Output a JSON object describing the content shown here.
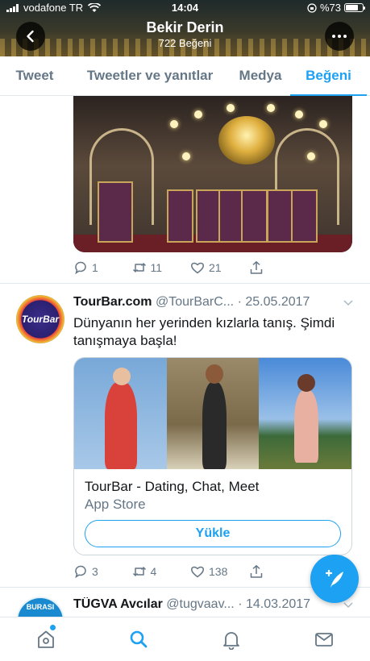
{
  "status_bar": {
    "carrier": "vodafone TR",
    "time": "14:04",
    "battery_text": "%73",
    "battery_level": 0.73
  },
  "header": {
    "name": "Bekir Derin",
    "subtitle": "722 Beğeni"
  },
  "tabs": [
    {
      "label": "Tweet",
      "active": false
    },
    {
      "label": "Tweetler ve yanıtlar",
      "active": false
    },
    {
      "label": "Medya",
      "active": false
    },
    {
      "label": "Beğeni",
      "active": true
    }
  ],
  "tweet1": {
    "actions": {
      "replies": "1",
      "retweets": "11",
      "likes": "21"
    }
  },
  "tweet2": {
    "display_name": "TourBar.com",
    "handle": "@TourBarC...",
    "date": "· 25.05.2017",
    "avatar_text": "TourBar",
    "text": "Dünyanın her yerinden kızlarla tanış. Şimdi tanışmaya başla!",
    "card": {
      "title": "TourBar - Dating, Chat, Meet",
      "source": "App Store",
      "button_label": "Yükle"
    },
    "actions": {
      "replies": "3",
      "retweets": "4",
      "likes": "138"
    }
  },
  "tweet3": {
    "display_name": "TÜGVA Avcılar",
    "handle": "@tugvaav...",
    "date": "· 14.03.2017",
    "avatar_text": "BURASI"
  },
  "colors": {
    "accent": "#1da1f2",
    "muted": "#657786",
    "text": "#14171a"
  }
}
